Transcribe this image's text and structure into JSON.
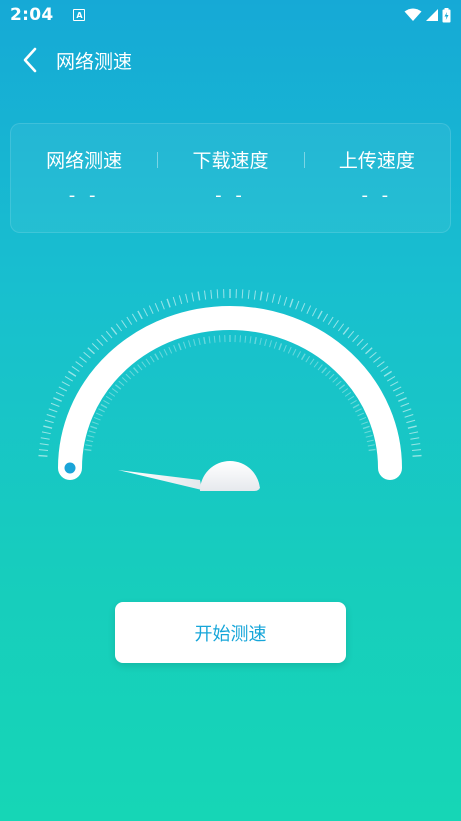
{
  "status_bar": {
    "time": "2:04",
    "notification_icon_letter": "A",
    "icons": [
      "wifi-icon",
      "signal-icon",
      "battery-icon"
    ]
  },
  "app_bar": {
    "back_icon": "chevron-left-icon",
    "title": "网络测速"
  },
  "stats": {
    "network": {
      "label": "网络测速",
      "value": "- -"
    },
    "download": {
      "label": "下载速度",
      "value": "- -"
    },
    "upload": {
      "label": "上传速度",
      "value": "- -"
    }
  },
  "gauge": {
    "level": 0,
    "indicator_color": "#1aa4d8"
  },
  "actions": {
    "start_label": "开始测速"
  },
  "colors": {
    "gradient_top": "#16a9d6",
    "gradient_bottom": "#16d6b6",
    "accent": "#17a6d9"
  }
}
